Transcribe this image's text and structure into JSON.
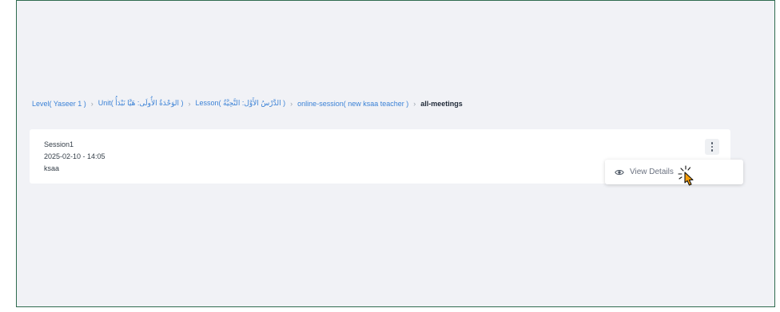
{
  "breadcrumb": {
    "items": [
      "Level( Yaseer 1 )",
      "Unit( الوَحْدَةُ الأُولَى: هَيَّا نَبْدَأُ )",
      "Lesson( الدَّرْسُ الأَوَّل: التَّحِيَّةُ )",
      "online-session( new ksaa teacher )"
    ],
    "current": "all-meetings",
    "separator": "›"
  },
  "session": {
    "name": "Session1",
    "datetime": "2025-02-10 - 14:05",
    "host": "ksaa"
  },
  "menu": {
    "view_details_label": "View Details"
  },
  "icons": {
    "more": "kebab-vertical-icon",
    "view": "eye-icon",
    "pointer": "hand-pointer-icon"
  },
  "colors": {
    "link": "#3b82d6",
    "frame_border": "#2f6b4f",
    "background": "#f1f2f6",
    "cursor_fill": "#f59e0b"
  }
}
